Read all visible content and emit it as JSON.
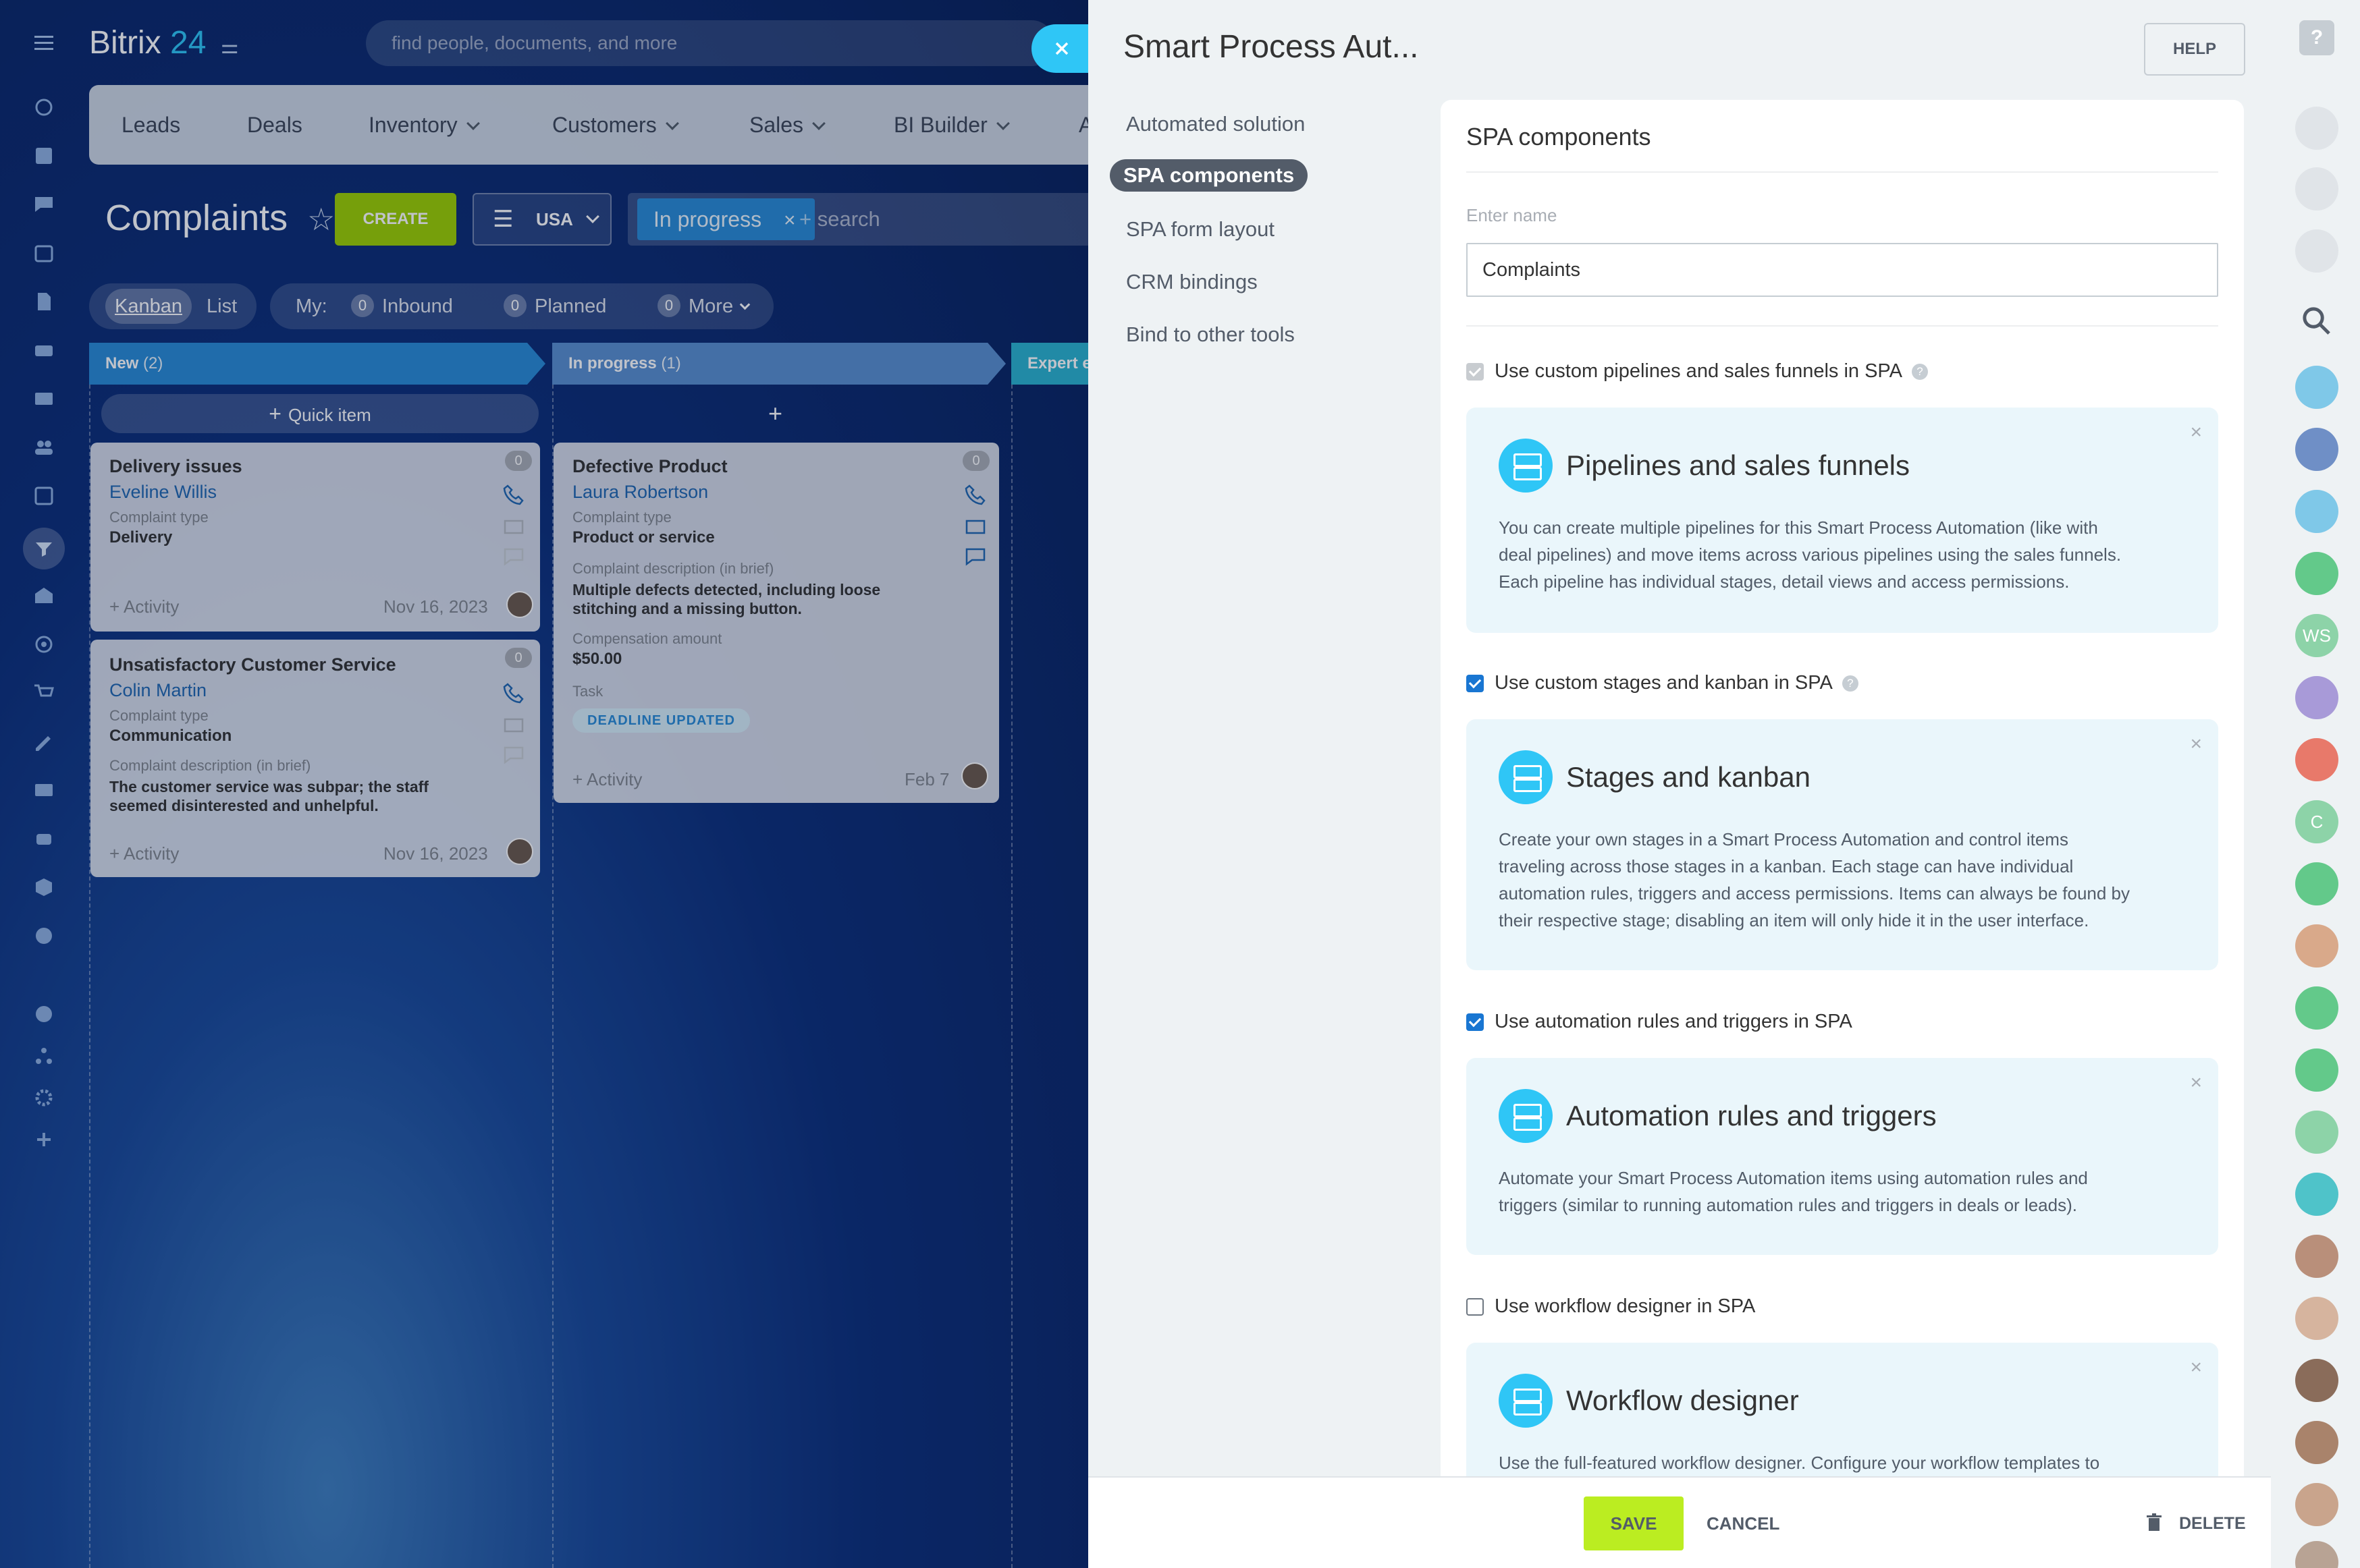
{
  "brand": {
    "name": "Bitrix",
    "num": "24"
  },
  "top_search": {
    "placeholder": "find people, documents, and more"
  },
  "nav": [
    "Leads",
    "Deals",
    "Inventory",
    "Customers",
    "Sales",
    "BI Builder",
    "A"
  ],
  "page": {
    "title": "Complaints",
    "create_label": "CREATE",
    "filter_label": "USA",
    "filter_chip": "In progress",
    "search_placeholder": "+ search"
  },
  "view_tabs": {
    "kanban": "Kanban",
    "list": "List"
  },
  "counters": {
    "my": "My:",
    "inbound_count": "0",
    "inbound": "Inbound",
    "planned_count": "0",
    "planned": "Planned",
    "more_count": "0",
    "more": "More"
  },
  "kanban": {
    "columns": [
      {
        "title": "New",
        "count": "(2)",
        "color": "#2a8bd6"
      },
      {
        "title": "In progress",
        "count": "(1)",
        "color": "#5a8fcf"
      },
      {
        "title": "Expert e",
        "count": "",
        "color": "#2bb3cf"
      }
    ],
    "quick_item": "Quick item",
    "add_symbol": "+",
    "cards": [
      {
        "title": "Delivery issues",
        "name": "Eveline Willis",
        "label1": "Complaint type",
        "value1": "Delivery",
        "activity": "+ Activity",
        "date": "Nov 16, 2023",
        "badge": "0"
      },
      {
        "title": "Unsatisfactory Customer Service",
        "name": "Colin Martin",
        "label1": "Complaint type",
        "value1": "Communication",
        "label2": "Complaint description (in brief)",
        "value2_line1": "The customer service was subpar; the staff",
        "value2_line2": "seemed disinterested and unhelpful.",
        "activity": "+ Activity",
        "date": "Nov 16, 2023",
        "badge": "0"
      },
      {
        "title": "Defective Product",
        "name": "Laura Robertson",
        "label1": "Complaint type",
        "value1": "Product or service",
        "label2": "Complaint description (in brief)",
        "value2_line1": "Multiple defects detected, including loose",
        "value2_line2": "stitching and a missing button.",
        "label3": "Compensation amount",
        "value3": "$50.00",
        "label4": "Task",
        "tag": "DEADLINE UPDATED",
        "activity": "+ Activity",
        "date": "Feb 7",
        "badge": "0"
      }
    ]
  },
  "panel": {
    "title": "Smart Process Aut...",
    "help": "HELP",
    "menu": [
      "Automated solution",
      "SPA components",
      "SPA form layout",
      "CRM bindings",
      "Bind to other tools"
    ],
    "active_menu": "SPA components",
    "section_title": "SPA components",
    "name_label": "Enter name",
    "name_value": "Complaints",
    "options": [
      {
        "label": "Use custom pipelines and sales funnels in SPA",
        "state": "disabled-checked",
        "help": "?",
        "box_title": "Pipelines and sales funnels",
        "box_lines": [
          "You can create multiple pipelines for this Smart Process Automation (like with",
          "deal pipelines) and move items across various pipelines using the sales funnels.",
          "Each pipeline has individual stages, detail views and access permissions."
        ]
      },
      {
        "label": "Use custom stages and kanban in SPA",
        "state": "checked",
        "help": "?",
        "box_title": "Stages and kanban",
        "box_lines": [
          "Create your own stages in a Smart Process Automation and control items",
          "traveling across those stages in a kanban. Each stage can have individual",
          "automation rules, triggers and access permissions. Items can always be found by",
          "their respective stage; disabling an item will only hide it in the user interface."
        ]
      },
      {
        "label": "Use automation rules and triggers in SPA",
        "state": "checked",
        "box_title": "Automation rules and triggers",
        "box_lines": [
          "Automate your Smart Process Automation items using automation rules and",
          "triggers (similar to running automation rules and triggers in deals or leads)."
        ]
      },
      {
        "label": "Use workflow designer in SPA",
        "state": "unchecked",
        "box_title": "Workflow designer",
        "box_lines": [
          "Use the full-featured workflow designer. Configure your workflow templates to"
        ]
      }
    ],
    "box_close": "×",
    "save": "SAVE",
    "cancel": "CANCEL",
    "delete": "DELETE"
  },
  "right_bar": {
    "ws_label": "WS",
    "c_label": "C",
    "help_label": "?"
  },
  "colors": {
    "accent": "#2fc6f6",
    "create_green": "#9dcf00",
    "save_green": "#bbed21",
    "checkbox_blue": "#1976d2"
  }
}
